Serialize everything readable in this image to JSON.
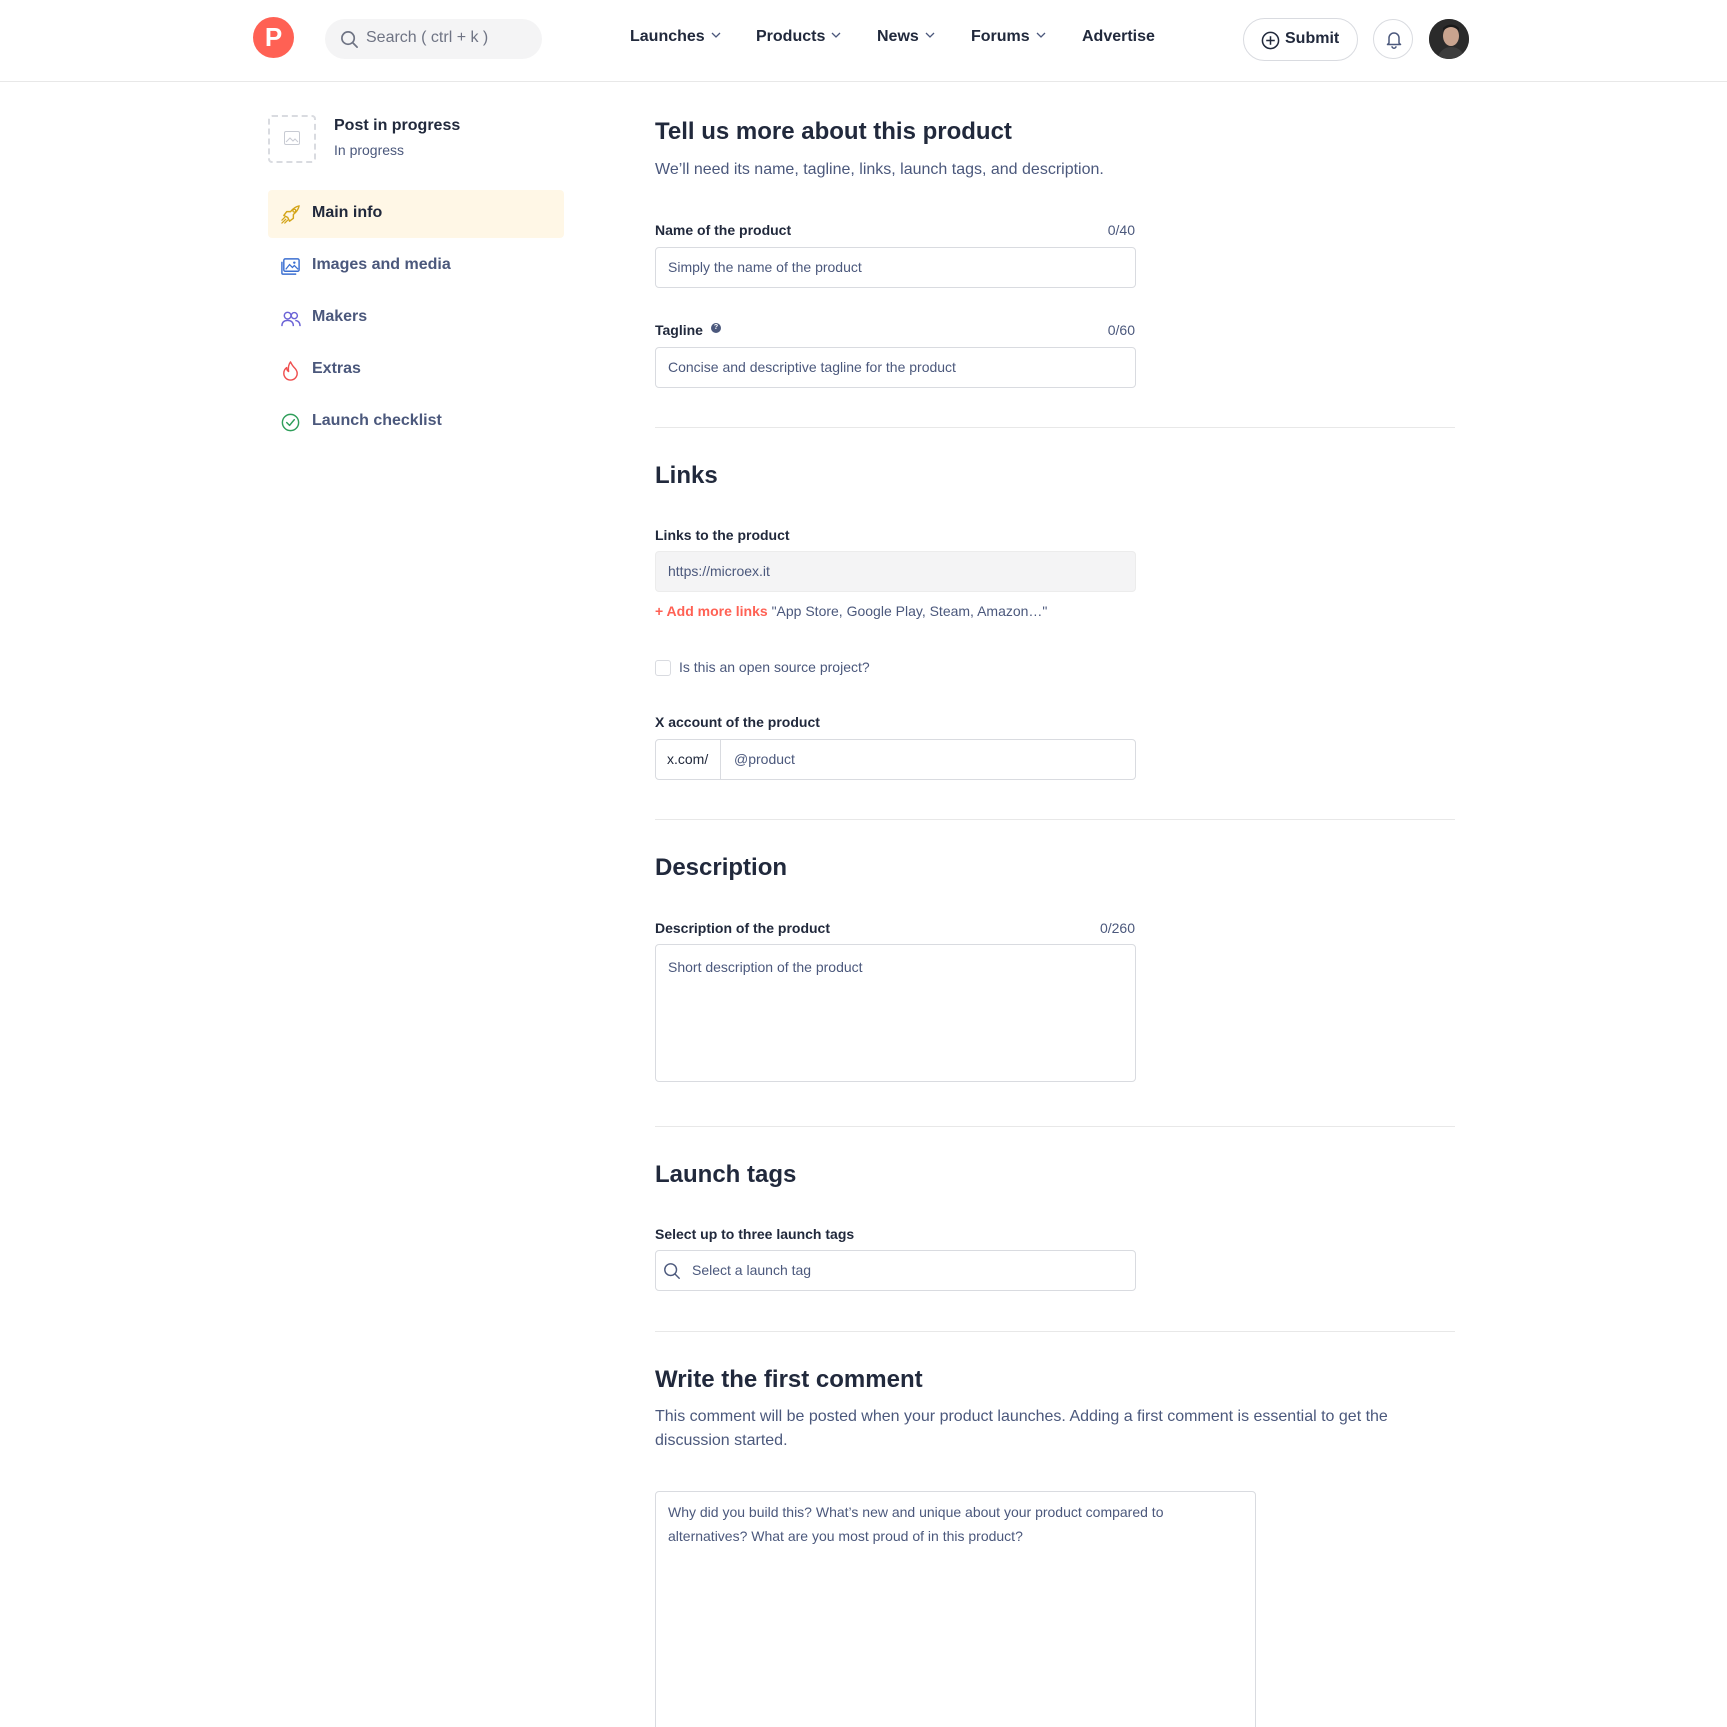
{
  "header": {
    "logo_letter": "P",
    "search_placeholder": "Search ( ctrl + k )",
    "nav": [
      {
        "label": "Launches",
        "has_dropdown": true
      },
      {
        "label": "Products",
        "has_dropdown": true
      },
      {
        "label": "News",
        "has_dropdown": true
      },
      {
        "label": "Forums",
        "has_dropdown": true
      },
      {
        "label": "Advertise",
        "has_dropdown": false
      }
    ],
    "submit_label": "Submit"
  },
  "sidebar": {
    "post_title": "Post in progress",
    "post_status": "In progress",
    "items": [
      {
        "label": "Main info",
        "icon": "rocket-icon",
        "active": true
      },
      {
        "label": "Images and media",
        "icon": "images-icon",
        "active": false
      },
      {
        "label": "Makers",
        "icon": "users-icon",
        "active": false
      },
      {
        "label": "Extras",
        "icon": "flame-icon",
        "active": false
      },
      {
        "label": "Launch checklist",
        "icon": "check-circle-icon",
        "active": false
      }
    ]
  },
  "main_info": {
    "title": "Tell us more about this product",
    "subtitle": "We’ll need its name, tagline, links, launch tags, and description.",
    "name_label": "Name of the product",
    "name_counter": "0/40",
    "name_placeholder": "Simply the name of the product",
    "tagline_label": "Tagline",
    "tagline_counter": "0/60",
    "tagline_placeholder": "Concise and descriptive tagline for the product"
  },
  "links": {
    "title": "Links",
    "links_label": "Links to the product",
    "link_value": "https://microex.it",
    "add_more_label": "+ Add more links",
    "add_more_hint": "\"App Store, Google Play, Steam, Amazon…\"",
    "open_source_label": "Is this an open source project?",
    "x_label": "X account of the product",
    "x_prefix": "x.com/",
    "x_placeholder": "@product"
  },
  "description": {
    "title": "Description",
    "label": "Description of the product",
    "counter": "0/260",
    "placeholder": "Short description of the product"
  },
  "launch_tags": {
    "title": "Launch tags",
    "label": "Select up to three launch tags",
    "placeholder": "Select a launch tag"
  },
  "first_comment": {
    "title": "Write the first comment",
    "subtitle": "This comment will be posted when your product launches. Adding a first comment is essential to get the discussion started.",
    "placeholder": "Why did you build this? What’s new and unique about your product compared to alternatives? What are you most proud of in this product?"
  },
  "colors": {
    "brand": "#ff6154",
    "active_bg": "#fff7e6",
    "text_primary": "#21293c",
    "text_secondary": "#4b587c"
  }
}
